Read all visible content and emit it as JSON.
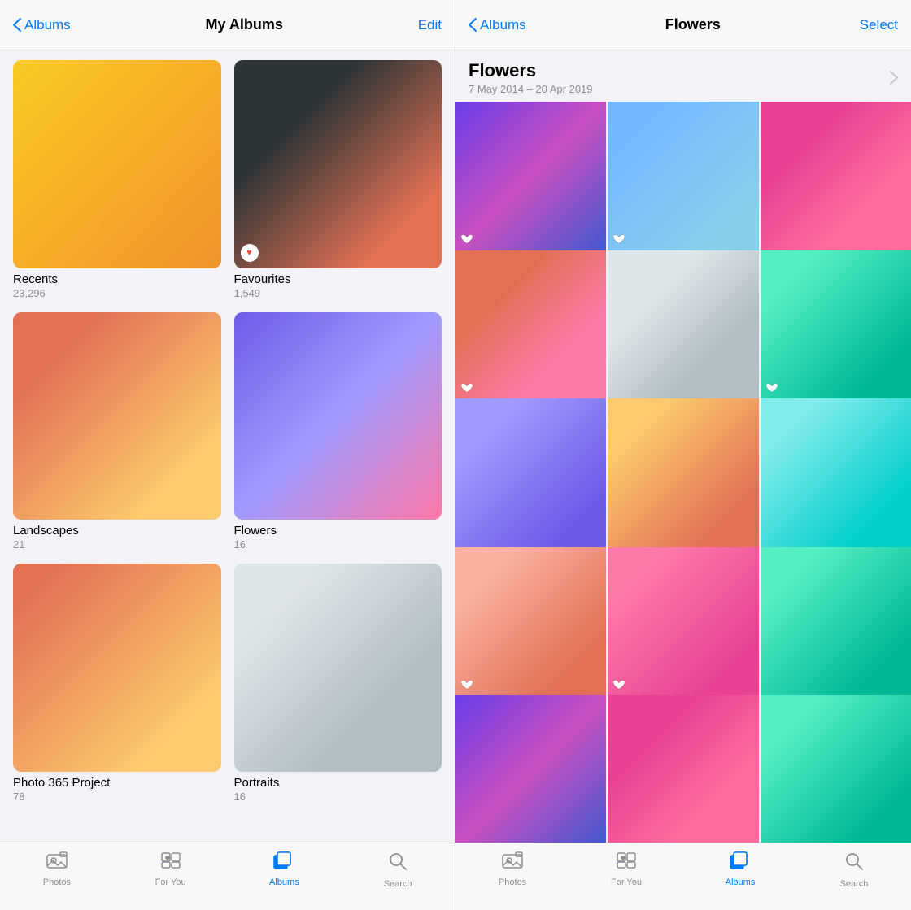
{
  "left": {
    "nav": {
      "back_label": "Albums",
      "title": "My Albums",
      "action_label": "Edit"
    },
    "albums": [
      {
        "id": "recents",
        "name": "Recents",
        "count": "23,296",
        "has_heart": false,
        "color_class": "album-recents"
      },
      {
        "id": "favourites",
        "name": "Favourites",
        "count": "1,549",
        "has_heart": true,
        "color_class": "album-favourites"
      },
      {
        "id": "landscapes",
        "name": "Landscapes",
        "count": "21",
        "has_heart": false,
        "color_class": "album-landscapes"
      },
      {
        "id": "flowers",
        "name": "Flowers",
        "count": "16",
        "has_heart": false,
        "color_class": "album-flowers"
      },
      {
        "id": "photo365",
        "name": "Photo 365 Project",
        "count": "78",
        "has_heart": false,
        "color_class": "album-photo365"
      },
      {
        "id": "portraits",
        "name": "Portraits",
        "count": "16",
        "has_heart": false,
        "color_class": "album-portraits"
      }
    ],
    "tabs": [
      {
        "id": "photos",
        "label": "Photos",
        "icon": "photos",
        "active": false
      },
      {
        "id": "for-you",
        "label": "For You",
        "icon": "foryou",
        "active": false
      },
      {
        "id": "albums",
        "label": "Albums",
        "icon": "albums",
        "active": true
      },
      {
        "id": "search",
        "label": "Search",
        "icon": "search",
        "active": false
      }
    ]
  },
  "right": {
    "nav": {
      "back_label": "Albums",
      "title": "Flowers",
      "action_label": "Select"
    },
    "header": {
      "title": "Flowers",
      "date_range": "7 May 2014 – 20 Apr 2019"
    },
    "photos": [
      {
        "id": "p1",
        "has_heart": true,
        "color_class": "c1"
      },
      {
        "id": "p2",
        "has_heart": true,
        "color_class": "c2"
      },
      {
        "id": "p3",
        "has_heart": false,
        "color_class": "c3"
      },
      {
        "id": "p4",
        "has_heart": true,
        "color_class": "c4"
      },
      {
        "id": "p5",
        "has_heart": false,
        "color_class": "c5"
      },
      {
        "id": "p6",
        "has_heart": true,
        "color_class": "c6"
      },
      {
        "id": "p7",
        "has_heart": false,
        "color_class": "c7"
      },
      {
        "id": "p8",
        "has_heart": false,
        "color_class": "c8"
      },
      {
        "id": "p9",
        "has_heart": false,
        "color_class": "c9"
      },
      {
        "id": "p10",
        "has_heart": true,
        "color_class": "c10"
      },
      {
        "id": "p11",
        "has_heart": true,
        "color_class": "c11"
      },
      {
        "id": "p12",
        "has_heart": false,
        "color_class": "c12"
      },
      {
        "id": "p13",
        "has_heart": false,
        "color_class": "c1"
      },
      {
        "id": "p14",
        "has_heart": false,
        "color_class": "c3"
      },
      {
        "id": "p15",
        "has_heart": false,
        "color_class": "c6"
      }
    ],
    "tabs": [
      {
        "id": "photos",
        "label": "Photos",
        "icon": "photos",
        "active": false
      },
      {
        "id": "for-you",
        "label": "For You",
        "icon": "foryou",
        "active": false
      },
      {
        "id": "albums",
        "label": "Albums",
        "icon": "albums",
        "active": true
      },
      {
        "id": "search",
        "label": "Search",
        "icon": "search",
        "active": false
      }
    ]
  }
}
